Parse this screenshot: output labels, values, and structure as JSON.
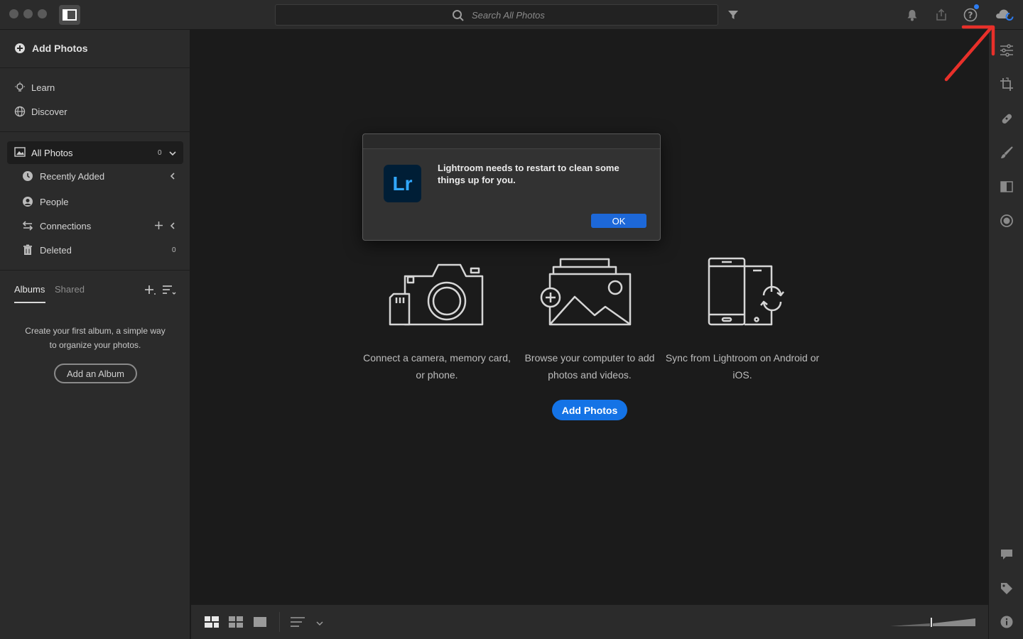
{
  "search": {
    "placeholder": "Search All Photos"
  },
  "sidebar": {
    "add_photos": "Add Photos",
    "learn": "Learn",
    "discover": "Discover",
    "all_photos": {
      "label": "All Photos",
      "count": "0"
    },
    "items": [
      {
        "label": "Recently Added"
      },
      {
        "label": "People"
      },
      {
        "label": "Connections"
      },
      {
        "label": "Deleted",
        "count": "0"
      }
    ],
    "tabs": {
      "albums": "Albums",
      "shared": "Shared"
    },
    "empty_text": "Create your first album, a simple way to organize your photos.",
    "add_album": "Add an Album"
  },
  "main": {
    "options": [
      {
        "text": "Connect a camera, memory card, or phone."
      },
      {
        "text": "Browse your computer to add photos and videos."
      },
      {
        "text": "Sync from Lightroom on Android or iOS."
      }
    ],
    "add_photos": "Add Photos"
  },
  "dialog": {
    "logo": "Lr",
    "message": "Lightroom needs to restart to clean some things up for you.",
    "ok": "OK"
  },
  "colors": {
    "accent": "#1473e6",
    "annotation": "#e8302a",
    "lr_logo_bg": "#001e36",
    "lr_logo_text": "#31a8ff"
  }
}
